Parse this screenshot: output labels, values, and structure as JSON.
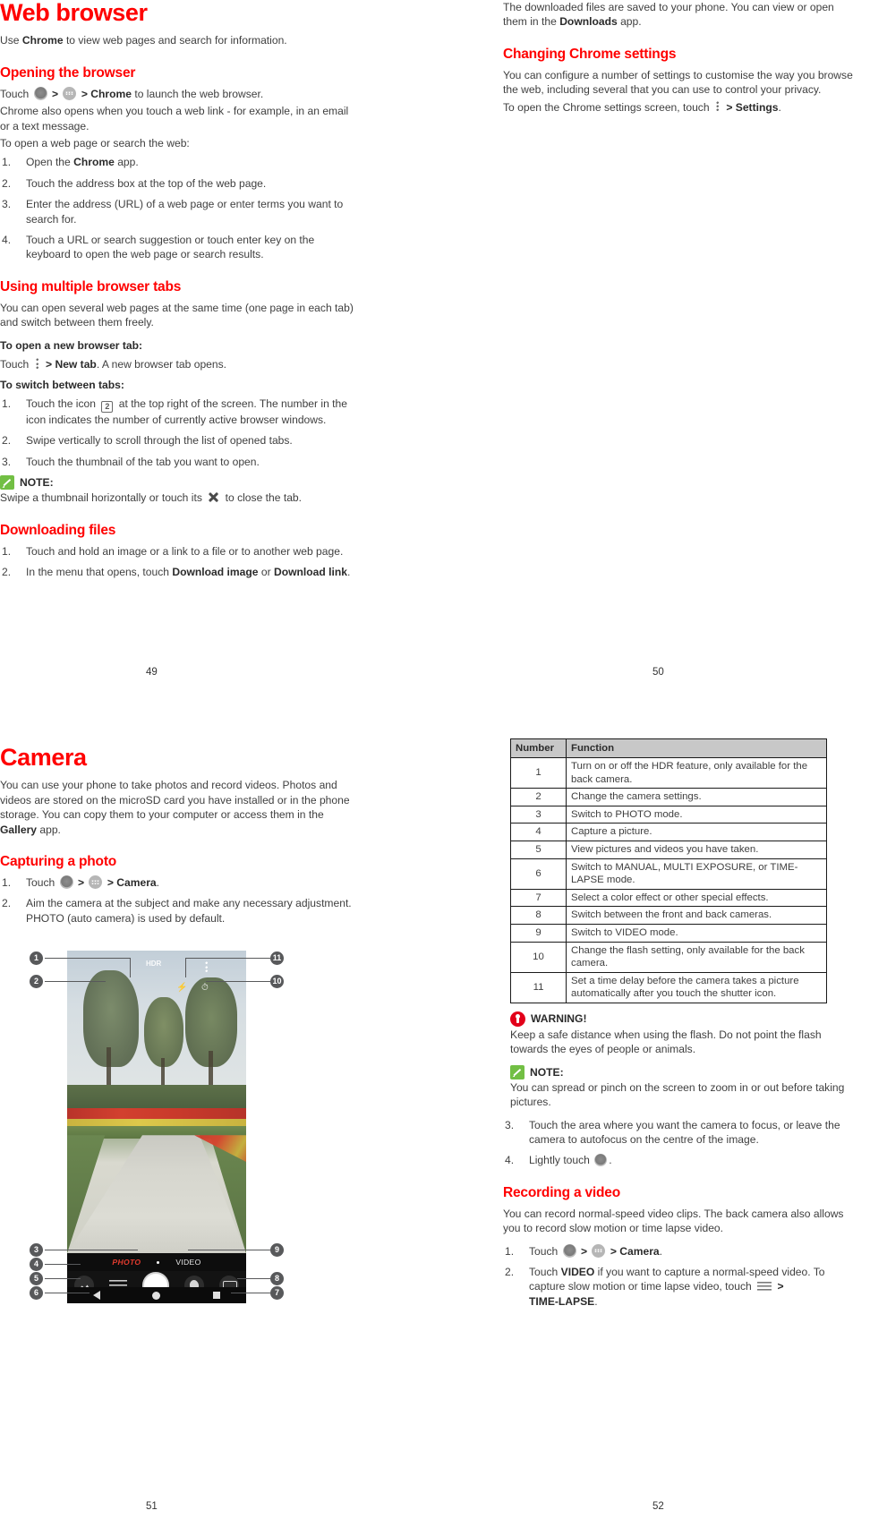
{
  "document": {
    "type": "user-manual-spread",
    "accent_color": "#ff0000",
    "note_badge_color": "#72bf44",
    "warning_badge_color": "#e2001a",
    "table_header_color": "#c8c8c8"
  },
  "page49": {
    "number": "49",
    "title": "Web browser",
    "intro_pre": "Use ",
    "intro_bold": "Chrome",
    "intro_post": " to view web pages and search for information.",
    "s1": {
      "heading": "Opening the browser",
      "touch_label": "Touch",
      "sep": ">",
      "chrome_bold": "> Chrome",
      "launch_text": " to launch the web browser.",
      "p1": "Chrome also opens when you touch a web link - for example, in an email or a text message.",
      "p2": "To open a web page or search the web:",
      "steps": [
        {
          "n": "1.",
          "pre": "Open the ",
          "bold": "Chrome",
          "post": " app."
        },
        {
          "n": "2.",
          "pre": "Touch the address box at the top of the web page.",
          "bold": "",
          "post": ""
        },
        {
          "n": "3.",
          "pre": "Enter the address (URL) of a web page or enter terms you want to search for.",
          "bold": "",
          "post": ""
        },
        {
          "n": "4.",
          "pre": "Touch a URL or search suggestion or touch enter key on the keyboard to open the web page or search results.",
          "bold": "",
          "post": ""
        }
      ]
    },
    "s2": {
      "heading": "Using multiple browser tabs",
      "p1": "You can open several web pages at the same time (one page in each tab) and switch between them freely.",
      "sub1": "To open a new browser tab:",
      "newtab_pre": "Touch",
      "newtab_bold": "> New tab",
      "newtab_post": ". A new browser tab opens.",
      "sub2": "To switch between tabs:",
      "steps": [
        {
          "n": "1.",
          "pre": "Touch the icon",
          "icon_value": "2",
          "post": "at the top right of the screen. The number in the icon indicates the number of currently active browser windows."
        },
        {
          "n": "2.",
          "pre": "Swipe vertically to scroll through the list of opened tabs.",
          "icon_value": "",
          "post": ""
        },
        {
          "n": "3.",
          "pre": "Touch the thumbnail of the tab you want to open.",
          "icon_value": "",
          "post": ""
        }
      ],
      "note_label": "NOTE:",
      "note_pre": "Swipe a thumbnail horizontally or touch its",
      "note_post": "to close the tab."
    },
    "s3": {
      "heading": "Downloading files",
      "steps": [
        {
          "n": "1.",
          "pre": "Touch and hold an image or a link to a file or to another web page.",
          "bold1": "",
          "mid": "",
          "bold2": "",
          "post": ""
        },
        {
          "n": "2.",
          "pre": "In the menu that opens, touch ",
          "bold1": "Download image",
          "mid": " or ",
          "bold2": "Download link",
          "post": "."
        }
      ]
    }
  },
  "page50": {
    "number": "50",
    "intro_pre": "The downloaded files are saved to your phone. You can view or open them in the ",
    "intro_bold": "Downloads",
    "intro_post": " app.",
    "s1": {
      "heading": "Changing Chrome settings",
      "p1": "You can configure a number of settings to customise the way you browse the web, including several that you can use to control your privacy.",
      "p2_pre": "To open the Chrome settings screen, touch",
      "p2_bold": "> Settings",
      "p2_post": "."
    }
  },
  "page51": {
    "number": "51",
    "title": "Camera",
    "intro_pre": "You can use your phone to take photos and record videos. Photos and videos are stored on the microSD card you have installed or in the phone storage. You can copy them to your computer or access them in the ",
    "intro_bold": "Gallery",
    "intro_post": " app.",
    "s1": {
      "heading": "Capturing a photo",
      "steps": [
        {
          "n": "1.",
          "pre": "Touch",
          "bold": "> Camera",
          "post": "."
        },
        {
          "n": "2.",
          "pre": "Aim the camera at the subject and make any necessary adjustment. PHOTO (auto camera) is used by default.",
          "bold": "",
          "post": ""
        }
      ]
    },
    "screenshot": {
      "callouts": [
        "1",
        "2",
        "3",
        "4",
        "5",
        "6",
        "7",
        "8",
        "9",
        "10",
        "11"
      ],
      "mode_photo": "PHOTO",
      "mode_video": "VIDEO"
    }
  },
  "page52": {
    "number": "52",
    "table": {
      "headers": [
        "Number",
        "Function"
      ],
      "rows": [
        [
          "1",
          "Turn on or off the HDR feature, only available for the back camera."
        ],
        [
          "2",
          "Change the camera settings."
        ],
        [
          "3",
          "Switch to PHOTO mode."
        ],
        [
          "4",
          "Capture a picture."
        ],
        [
          "5",
          "View pictures and videos you have taken."
        ],
        [
          "6",
          "Switch to MANUAL, MULTI EXPOSURE, or TIME-LAPSE mode."
        ],
        [
          "7",
          "Select a color effect or other special effects."
        ],
        [
          "8",
          "Switch between the front and back cameras."
        ],
        [
          "9",
          "Switch to VIDEO mode."
        ],
        [
          "10",
          "Change the flash setting, only available for the back camera."
        ],
        [
          "11",
          "Set a time delay before the camera takes a picture automatically after you touch the shutter icon."
        ]
      ]
    },
    "warning": {
      "label": "WARNING!",
      "text": "Keep a safe distance when using the flash. Do not point the flash towards the eyes of people or animals."
    },
    "note": {
      "label": "NOTE:",
      "text": "You can spread or pinch on the screen to zoom in or out before taking pictures."
    },
    "steps_cont": [
      {
        "n": "3.",
        "pre": "Touch the area where you want the camera to focus, or leave the camera to autofocus on the centre of the image.",
        "post": ""
      },
      {
        "n": "4.",
        "pre": "Lightly touch",
        "post": "."
      }
    ],
    "s_video": {
      "heading": "Recording a video",
      "p1": "You can record normal-speed video clips. The back camera also allows you to record slow motion or time lapse video.",
      "steps": [
        {
          "n": "1.",
          "pre": "Touch",
          "bold": "> Camera",
          "post": "."
        },
        {
          "n": "2.",
          "pre_a": "Touch ",
          "bold_a": "VIDEO",
          "post_a": " if you want to capture a normal-speed video. To capture slow motion or time lapse video, touch",
          "bold_b": ">",
          "bold_c": "TIME-LAPSE",
          "post_b": "."
        }
      ]
    }
  }
}
